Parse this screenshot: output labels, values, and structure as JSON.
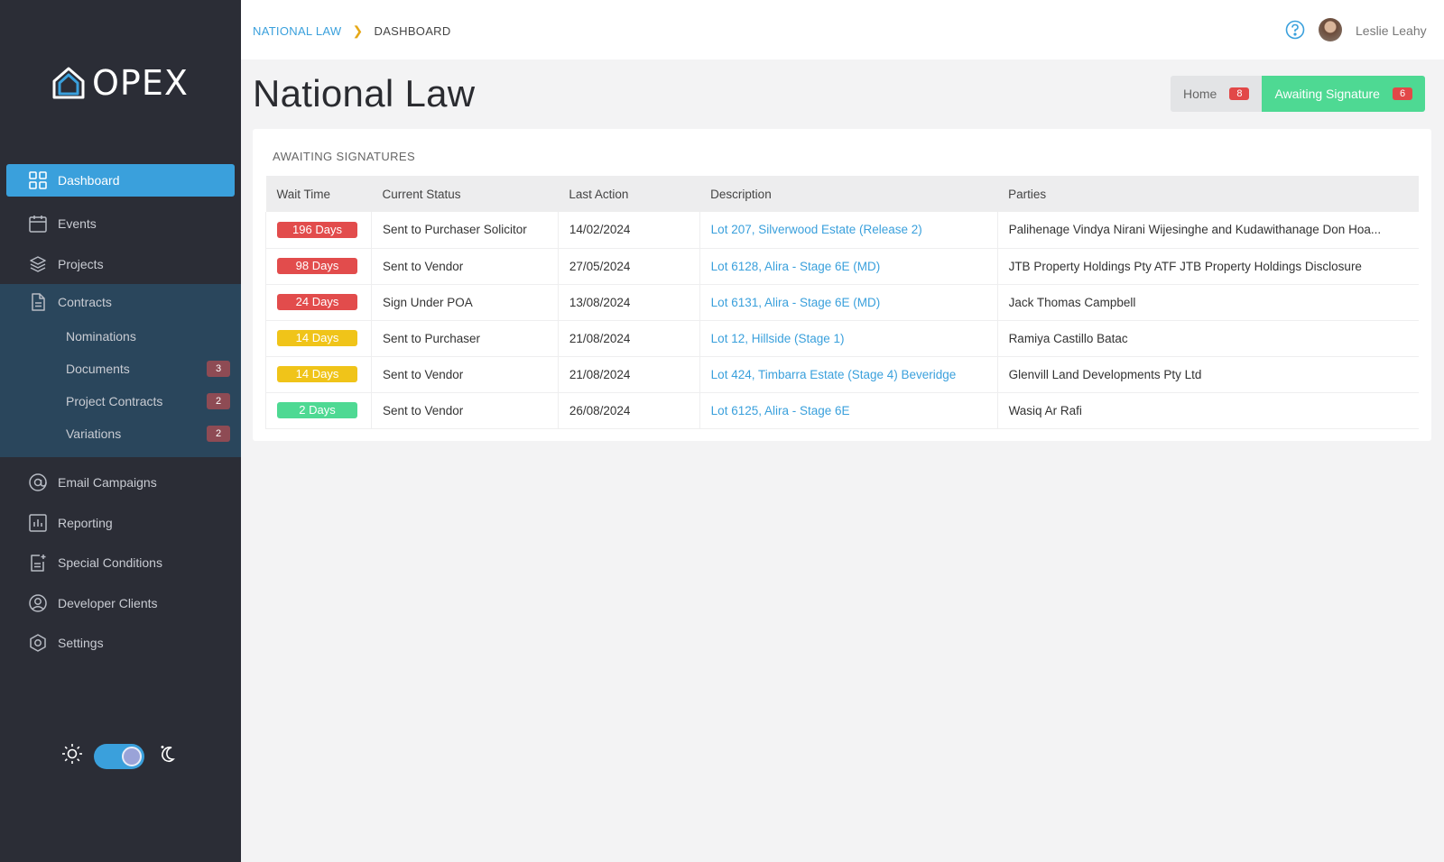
{
  "app": {
    "logo_text": "OPEX"
  },
  "sidebar": {
    "items": [
      {
        "label": "Dashboard",
        "icon": "grid-icon",
        "active": true
      },
      {
        "label": "Events",
        "icon": "calendar-icon"
      },
      {
        "label": "Projects",
        "icon": "layers-icon"
      },
      {
        "label": "Contracts",
        "icon": "document-icon"
      },
      {
        "label": "Email Campaigns",
        "icon": "at-sign-icon"
      },
      {
        "label": "Reporting",
        "icon": "bar-chart-icon"
      },
      {
        "label": "Special Conditions",
        "icon": "document-plus-icon"
      },
      {
        "label": "Developer Clients",
        "icon": "user-circle-icon"
      },
      {
        "label": "Settings",
        "icon": "settings-icon"
      }
    ],
    "contracts_sub": [
      {
        "label": "Nominations",
        "count": ""
      },
      {
        "label": "Documents",
        "count": "3"
      },
      {
        "label": "Project Contracts",
        "count": "2"
      },
      {
        "label": "Variations",
        "count": "2"
      }
    ],
    "theme_toggle": {
      "state": "on"
    }
  },
  "header": {
    "breadcrumb": {
      "link": "NATIONAL LAW",
      "current": "DASHBOARD"
    },
    "user_name": "Leslie Leahy"
  },
  "page": {
    "title": "National Law",
    "tabs": [
      {
        "label": "Home",
        "count": "8"
      },
      {
        "label": "Awaiting Signature",
        "count": "6"
      }
    ]
  },
  "card": {
    "title": "AWAITING SIGNATURES",
    "columns": [
      "Wait Time",
      "Current Status",
      "Last Action",
      "Description",
      "Parties"
    ],
    "rows": [
      {
        "wait": "196 Days",
        "wait_color": "#e24c4c",
        "status": "Sent to Purchaser Solicitor",
        "last_action": "14/02/2024",
        "description": "Lot 207, Silverwood Estate (Release 2)",
        "parties": "Palihenage Vindya Nirani Wijesinghe and Kudawithanage Don Hoa..."
      },
      {
        "wait": "98 Days",
        "wait_color": "#e24c4c",
        "status": "Sent to Vendor",
        "last_action": "27/05/2024",
        "description": "Lot 6128, Alira - Stage 6E (MD)",
        "parties": "JTB Property Holdings Pty ATF JTB Property Holdings Disclosure"
      },
      {
        "wait": "24 Days",
        "wait_color": "#e24c4c",
        "status": "Sign Under POA",
        "last_action": "13/08/2024",
        "description": "Lot 6131, Alira - Stage 6E (MD)",
        "parties": "Jack Thomas Campbell"
      },
      {
        "wait": "14 Days",
        "wait_color": "#f0c419",
        "status": "Sent to Purchaser",
        "last_action": "21/08/2024",
        "description": "Lot 12, Hillside (Stage 1)",
        "parties": "Ramiya Castillo Batac"
      },
      {
        "wait": "14 Days",
        "wait_color": "#f0c419",
        "status": "Sent to Vendor",
        "last_action": "21/08/2024",
        "description": "Lot 424, Timbarra Estate (Stage 4) Beveridge",
        "parties": "Glenvill Land Developments Pty Ltd"
      },
      {
        "wait": "2 Days",
        "wait_color": "#4ed993",
        "status": "Sent to Vendor",
        "last_action": "26/08/2024",
        "description": "Lot 6125, Alira - Stage 6E",
        "parties": "Wasiq Ar Rafi"
      }
    ]
  },
  "colors": {
    "sidebar_bg": "#2b2d36",
    "accent_blue": "#3aa0dc",
    "accent_green": "#4ed993",
    "danger_red": "#e24c4c",
    "warning_yellow": "#f0c419"
  }
}
